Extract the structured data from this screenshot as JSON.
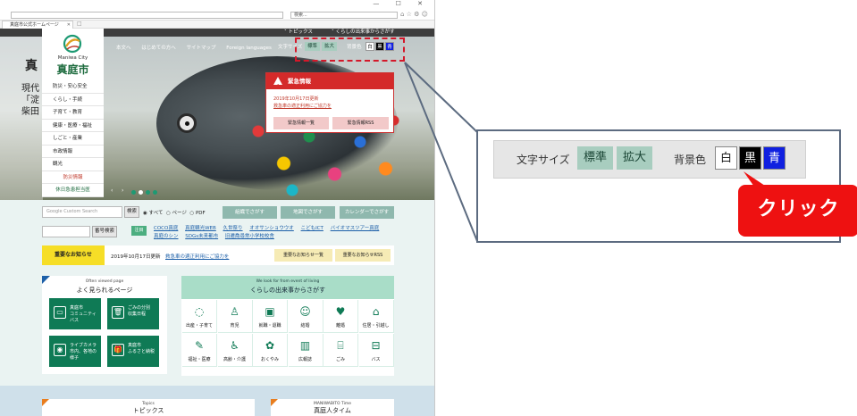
{
  "browser": {
    "address": "",
    "search_placeholder": "検索...",
    "tab_title": "真庭市公式ホームページ",
    "window_controls": "— ☐ ✕",
    "tool_icons": "⌂ ☆ ⚙ ☺"
  },
  "topbar": {
    "news": "˅ トピックス",
    "events": "˅ くらしの出来事からさがす"
  },
  "hero": {
    "big_text": "真",
    "sub_text": [
      "現代",
      "「淀",
      "柴田"
    ]
  },
  "logo": {
    "en": "Maniwa City",
    "jp": "真庭市"
  },
  "nav": {
    "items": [
      "本文へ",
      "はじめての方へ",
      "サイトマップ",
      "Foreign languages"
    ]
  },
  "text_size": {
    "label": "文字サイズ",
    "standard": "標準",
    "large": "拡大"
  },
  "bg_color": {
    "label": "背景色",
    "white": "白",
    "black": "黒",
    "blue": "青"
  },
  "side_menu": {
    "items": [
      "防災・安心安全",
      "くらし・手続",
      "子育て・教育",
      "健康・医療・福祉",
      "しごと・産業",
      "市政情報",
      "観光"
    ],
    "disaster": "防災情報",
    "holiday": "休日急患担当医"
  },
  "emergency": {
    "title": "緊急情報",
    "date": "2019年10月17日更新",
    "link": "救急車の適正利用にご協力を",
    "btn_list": "緊急情報一覧",
    "btn_rss": "緊急情報RSS"
  },
  "search": {
    "google_placeholder": "Google   Custom Search",
    "button": "検索",
    "radio_all": "◉ すべて",
    "radio_page": "○ ページ",
    "radio_pdf": "○ PDF",
    "btn_org": "組織でさがす",
    "btn_map": "地図でさがす",
    "btn_cal": "カレンダーでさがす",
    "num_button": "番号検索"
  },
  "attention": {
    "label": "注目",
    "links": [
      "COCO真庭",
      "真庭観光WEB",
      "久世祭り",
      "オオサンショウウオ",
      "こどもICT",
      "バイオマスツアー真庭",
      "真庭のシン",
      "SDGs未来都市",
      "旧遷喬尋常小学校校舎"
    ]
  },
  "notice": {
    "label": "重要なお知らせ",
    "date": "2019年10月17日更新",
    "link": "救急車の適正利用にご協力を",
    "btn_list": "重要なお知らせ一覧",
    "btn_rss": "重要なお知らせRSS"
  },
  "often_viewed": {
    "sub": "Often viewed page",
    "title": "よく見られるページ",
    "tiles": [
      {
        "icon": "bus-icon",
        "glyph": "▭",
        "label": "真庭市\nコミュニティ\nバス"
      },
      {
        "icon": "trash-icon",
        "glyph": "🗑",
        "label": "ごみの分別\n収集日程"
      },
      {
        "icon": "camera-icon",
        "glyph": "◉",
        "label": "ライブカメラ\n市内、各地の\n様子"
      },
      {
        "icon": "gift-icon",
        "glyph": "🎁",
        "label": "真庭市\nふるさと納税"
      }
    ]
  },
  "life_events": {
    "sub": "We look for from event of living",
    "title": "くらしの出来事からさがす",
    "cells": [
      {
        "icon": "birth-icon",
        "glyph": "◌",
        "label": "出産・子育て"
      },
      {
        "icon": "bottle-icon",
        "glyph": "♙",
        "label": "育児"
      },
      {
        "icon": "briefcase-icon",
        "glyph": "▣",
        "label": "就職・退職"
      },
      {
        "icon": "wedding-icon",
        "glyph": "☺",
        "label": "結婚"
      },
      {
        "icon": "broken-heart-icon",
        "glyph": "♥",
        "label": "離婚"
      },
      {
        "icon": "house-icon",
        "glyph": "⌂",
        "label": "住居・引越し"
      },
      {
        "icon": "syringe-icon",
        "glyph": "✎",
        "label": "福祉・医療"
      },
      {
        "icon": "elderly-icon",
        "glyph": "♿",
        "label": "高齢・介護"
      },
      {
        "icon": "lotus-icon",
        "glyph": "✿",
        "label": "おくやみ"
      },
      {
        "icon": "book-icon",
        "glyph": "▥",
        "label": "広報誌"
      },
      {
        "icon": "trash-icon",
        "glyph": "⌸",
        "label": "ごみ"
      },
      {
        "icon": "bus-icon",
        "glyph": "⊟",
        "label": "バス"
      }
    ]
  },
  "bottom": {
    "topics_sub": "Topics",
    "topics_title": "トピックス",
    "time_sub": "MANIWABITO Time",
    "time_title": "真庭人タイム"
  },
  "callout": {
    "click": "クリック",
    "accent_color": "#ee1111",
    "dash_color": "#d4182a",
    "line_color": "#5c6b80"
  }
}
